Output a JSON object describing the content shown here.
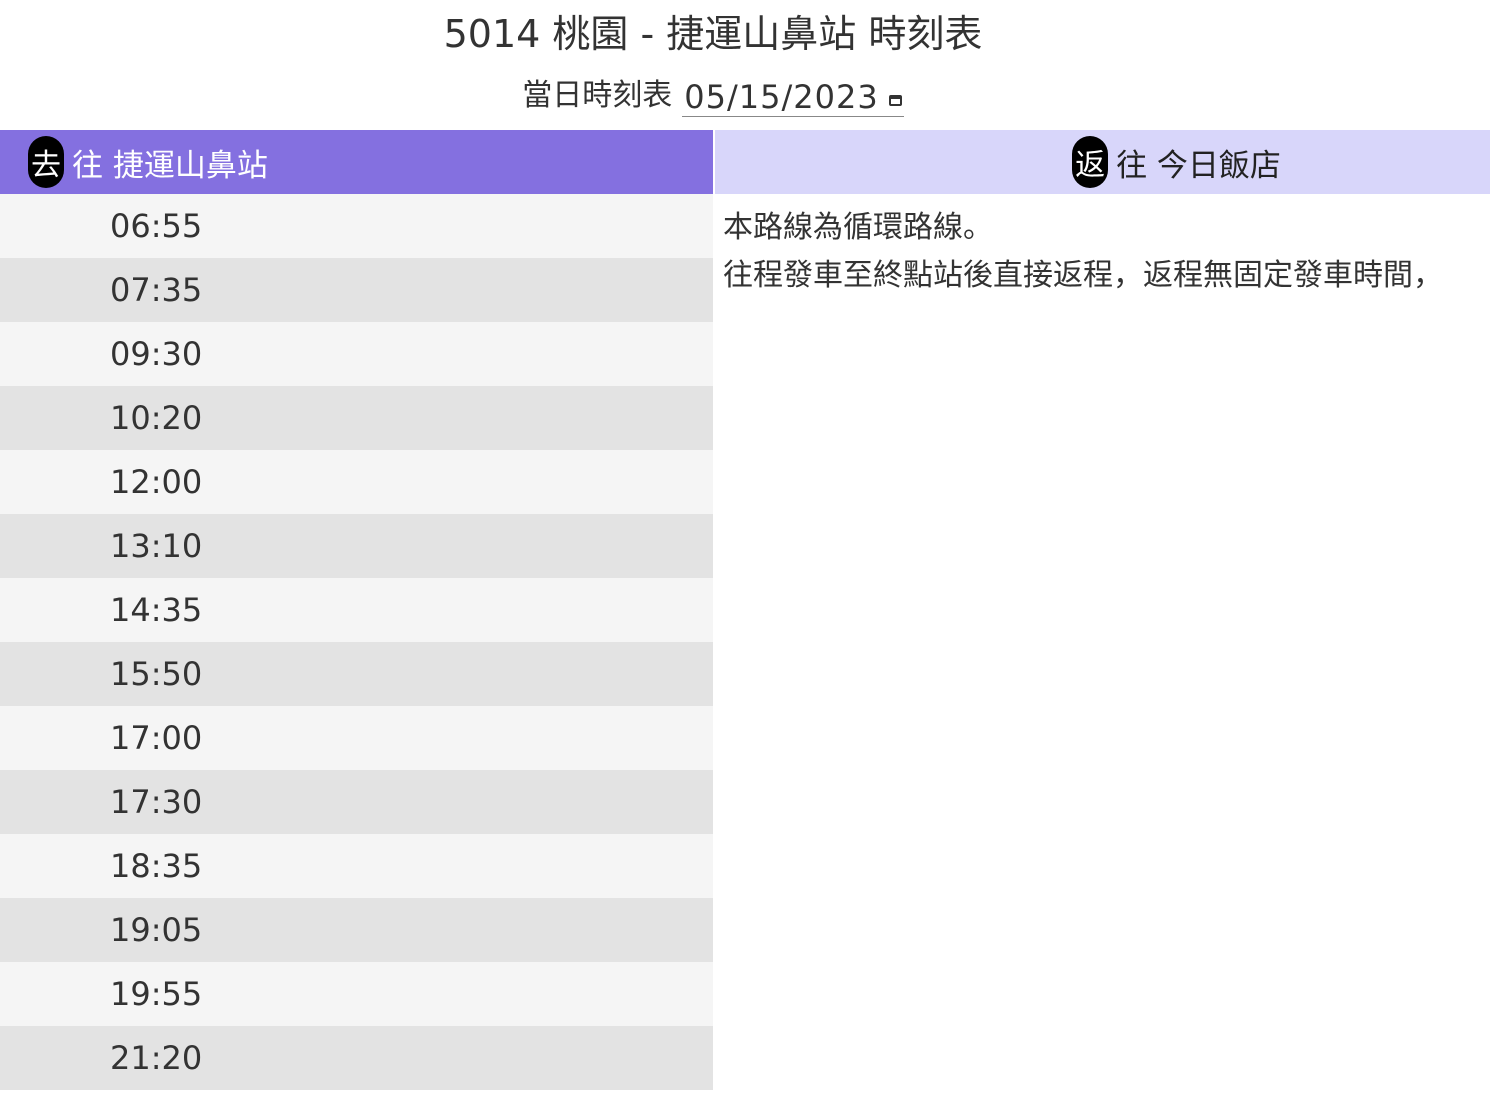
{
  "page": {
    "title": "5014 桃園 - 捷運山鼻站 時刻表"
  },
  "date_picker": {
    "label": "當日時刻表",
    "value": "05/15/2023",
    "icon": "calendar-icon"
  },
  "outbound": {
    "badge": "去",
    "direction": "往 捷運山鼻站",
    "times": [
      "06:55",
      "07:35",
      "09:30",
      "10:20",
      "12:00",
      "13:10",
      "14:35",
      "15:50",
      "17:00",
      "17:30",
      "18:35",
      "19:05",
      "19:55",
      "21:20"
    ]
  },
  "return": {
    "badge": "返",
    "direction": "往 今日飯店",
    "note_lines": [
      "本路線為循環路線。",
      "往程發車至終點站後直接返程，返程無固定發車時間，"
    ]
  },
  "colors": {
    "outbound_header": "#8470e0",
    "return_header": "#d8d6fa",
    "row_light": "#f5f5f5",
    "row_dark": "#e3e3e3",
    "badge": "#000000"
  }
}
